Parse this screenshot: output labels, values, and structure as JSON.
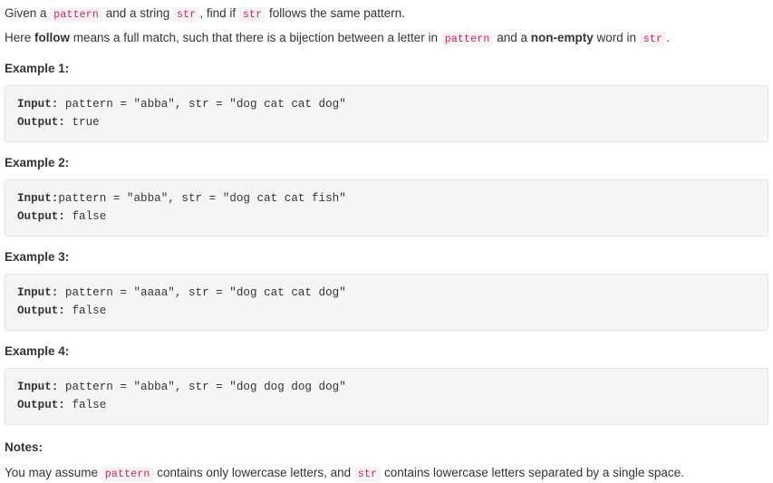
{
  "intro": {
    "line1": {
      "seg1": "Given a ",
      "code1": "pattern",
      "seg2": " and a string ",
      "code2": "str",
      "seg3": ", find if ",
      "code3": "str",
      "seg4": " follows the same pattern."
    },
    "line2": {
      "seg1": "Here ",
      "bold1": "follow",
      "seg2": " means a full match, such that there is a bijection between a letter in ",
      "code1": "pattern",
      "seg3": " and a ",
      "bold2": "non-empty",
      "seg4": " word in ",
      "code2": "str",
      "seg5": "."
    }
  },
  "examples": [
    {
      "heading": "Example 1:",
      "input_label": "Input:",
      "input_body": " pattern = \"abba\", str = \"dog cat cat dog\"",
      "output_label": "Output:",
      "output_body": " true"
    },
    {
      "heading": "Example 2:",
      "input_label": "Input:",
      "input_body": "pattern = \"abba\", str = \"dog cat cat fish\"",
      "output_label": "Output:",
      "output_body": " false"
    },
    {
      "heading": "Example 3:",
      "input_label": "Input:",
      "input_body": " pattern = \"aaaa\", str = \"dog cat cat dog\"",
      "output_label": "Output:",
      "output_body": " false"
    },
    {
      "heading": "Example 4:",
      "input_label": "Input:",
      "input_body": " pattern = \"abba\", str = \"dog dog dog dog\"",
      "output_label": "Output:",
      "output_body": " false"
    }
  ],
  "notes": {
    "heading": "Notes:",
    "seg1": "You may assume ",
    "code1": "pattern",
    "seg2": " contains only lowercase letters, and ",
    "code2": "str",
    "seg3": " contains lowercase letters separated by a single space."
  },
  "colors": {
    "inline_code_text": "#c7254e",
    "inline_code_bg": "#f9f2f4",
    "code_block_bg": "#f5f5f5",
    "code_block_border": "#e3e3e3",
    "body_text": "#333333",
    "page_bg": "#ffffff"
  }
}
